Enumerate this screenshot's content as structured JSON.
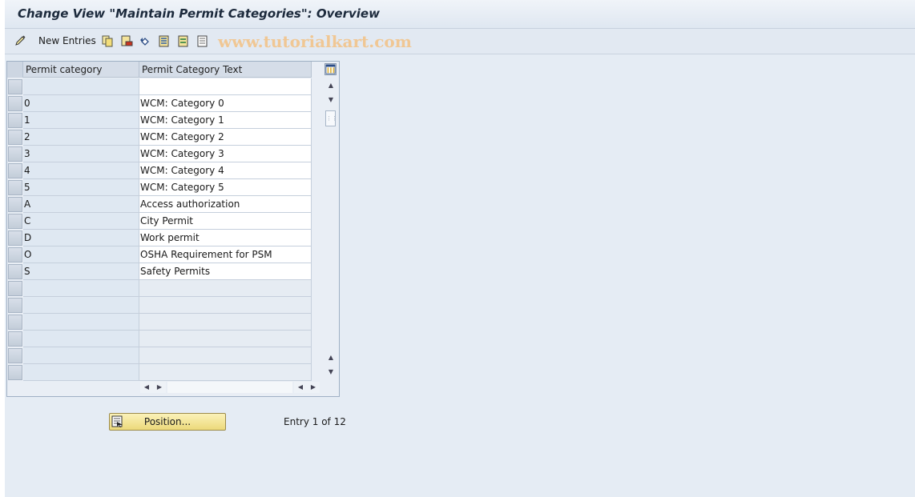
{
  "title": "Change View \"Maintain Permit Categories\": Overview",
  "toolbar": {
    "new_entries_label": "New Entries",
    "icons": [
      "edit-pencil-icon",
      "copy-icon",
      "delete-icon",
      "undo-icon",
      "select-all-icon",
      "select-block-icon",
      "deselect-all-icon"
    ]
  },
  "watermark": "www.tutorialkart.com",
  "table": {
    "columns": [
      "Permit category",
      "Permit Category Text"
    ],
    "rows": [
      {
        "key": "",
        "text": ""
      },
      {
        "key": "0",
        "text": "WCM: Category 0"
      },
      {
        "key": "1",
        "text": "WCM: Category 1"
      },
      {
        "key": "2",
        "text": "WCM: Category 2"
      },
      {
        "key": "3",
        "text": "WCM: Category 3"
      },
      {
        "key": "4",
        "text": "WCM: Category 4"
      },
      {
        "key": "5",
        "text": "WCM: Category 5"
      },
      {
        "key": "A",
        "text": "Access authorization"
      },
      {
        "key": "C",
        "text": "City Permit"
      },
      {
        "key": "D",
        "text": "Work permit"
      },
      {
        "key": "O",
        "text": "OSHA Requirement for PSM"
      },
      {
        "key": "S",
        "text": "Safety Permits"
      },
      {
        "key": "",
        "text": ""
      },
      {
        "key": "",
        "text": ""
      },
      {
        "key": "",
        "text": ""
      },
      {
        "key": "",
        "text": ""
      },
      {
        "key": "",
        "text": ""
      },
      {
        "key": "",
        "text": ""
      }
    ]
  },
  "position_button_label": "Position...",
  "entry_info": "Entry 1 of 12",
  "colors": {
    "background": "#e5ecf4",
    "key_column": "#dfe8f2",
    "button": "#f3e39a",
    "watermark": "#f2c48a"
  }
}
